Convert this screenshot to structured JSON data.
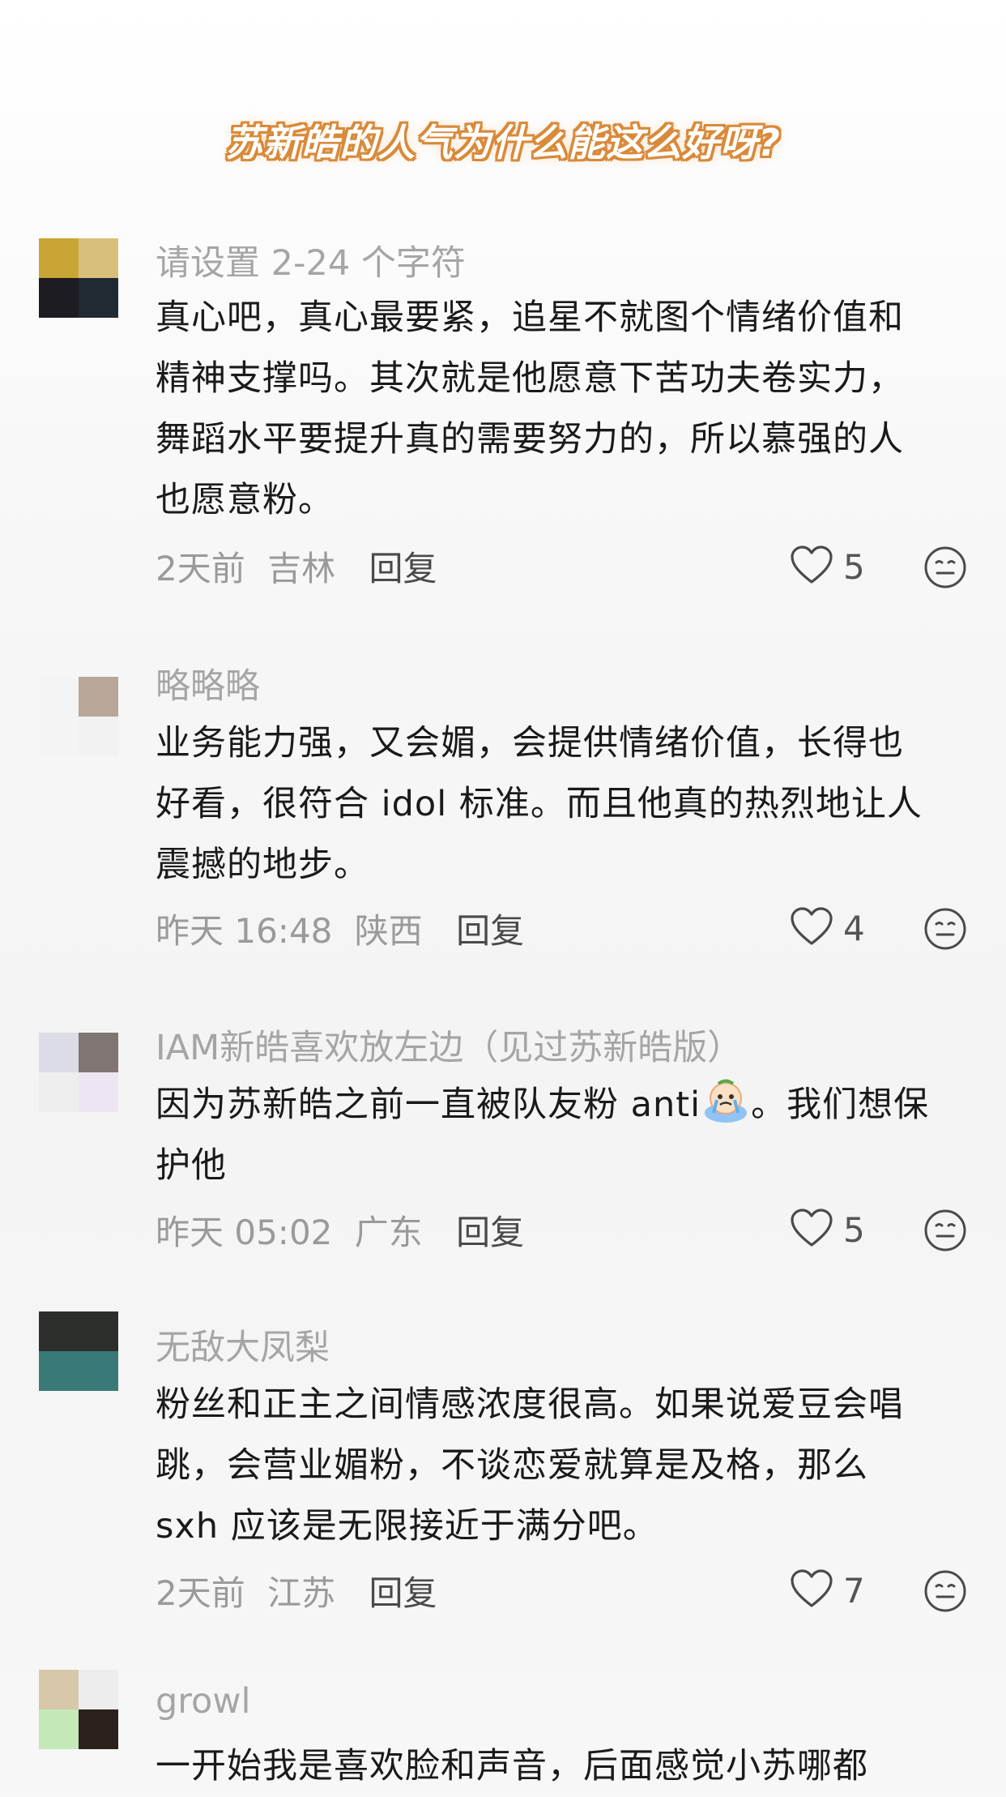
{
  "headline": "苏新皓的人气为什么能这么好呀?",
  "comments": [
    {
      "username": "请设置 2-24 个字符",
      "lines": [
        "真心吧，真心最要紧，追星不就图个情绪价值和",
        "精神支撑吗。其次就是他愿意下苦功夫卷实力，",
        "舞蹈水平要提升真的需要努力的，所以慕强的人",
        "也愿意粉。"
      ],
      "time": "2天前",
      "location": "吉林",
      "reply_label": "回复",
      "likes": "5",
      "avatar_colors": [
        "#c9a536",
        "#d8bf7a",
        "#1c1c22",
        "#1f2a33"
      ]
    },
    {
      "username": "略略略",
      "lines": [
        "业务能力强，又会媚，会提供情绪价值，长得也",
        "好看，很符合 idol 标准。而且他真的热烈地让人",
        "震撼的地步。"
      ],
      "time": "昨天 16:48",
      "location": "陕西",
      "reply_label": "回复",
      "likes": "4",
      "avatar_colors": [
        "#f4f4f4",
        "#b8a69a",
        "#f4f4f4",
        "#f2f2f2"
      ]
    },
    {
      "username": "IAM新皓喜欢放左边（见过苏新皓版）",
      "line1_before": "因为苏新皓之前一直被队友粉 anti",
      "line1_after": "。我们想保",
      "line2": "护他",
      "emoji_name": "crying-emoji",
      "time": "昨天 05:02",
      "location": "广东",
      "reply_label": "回复",
      "likes": "5",
      "avatar_colors": [
        "#dcdce6",
        "#7f7572",
        "#eeeeee",
        "#ede6f2"
      ]
    },
    {
      "username": "无敌大凤梨",
      "lines": [
        "粉丝和正主之间情感浓度很高。如果说爱豆会唱",
        "跳，会营业媚粉，不谈恋爱就算是及格，那么",
        " sxh 应该是无限接近于满分吧。"
      ],
      "time": "2天前",
      "location": "江苏",
      "reply_label": "回复",
      "likes": "7",
      "avatar_colors": [
        "#2b2e2b",
        "#2b2e2b",
        "#3a7a76",
        "#3a7a76"
      ]
    },
    {
      "username": "growl",
      "lines": [
        "一开始我是喜欢脸和声音，后面感觉小苏哪都"
      ],
      "avatar_colors": [
        "#d6c8a8",
        "#ededed",
        "#c4e8b8",
        "#2a211d"
      ]
    }
  ],
  "icons": {
    "like": "heart-outline-icon",
    "react": "smiley-face-icon"
  }
}
